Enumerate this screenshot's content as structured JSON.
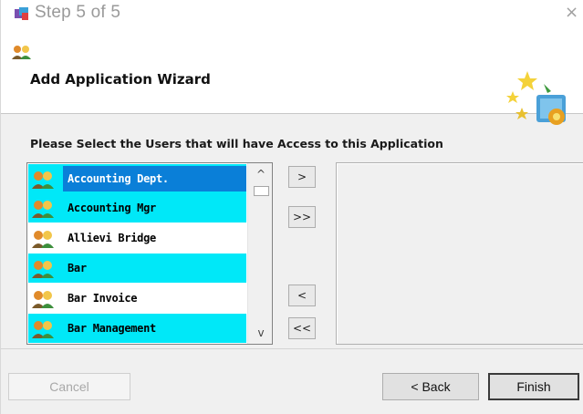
{
  "window": {
    "title": "Step 5 of 5",
    "close_glyph": "×"
  },
  "header": {
    "title": "Add Application Wizard",
    "small_icon": "users-icon",
    "art_icon": "wizard-stars-icon"
  },
  "instruction": "Please Select the Users that will have Access to this Application",
  "user_list": {
    "items": [
      {
        "label": "Accounting Dept.",
        "state": "selected"
      },
      {
        "label": "Accounting Mgr",
        "state": "highlighted"
      },
      {
        "label": "Allievi Bridge",
        "state": "normal"
      },
      {
        "label": "Bar",
        "state": "highlighted"
      },
      {
        "label": "Bar Invoice",
        "state": "normal"
      },
      {
        "label": "Bar Management",
        "state": "highlighted"
      }
    ],
    "scroll_up": "^",
    "scroll_down": "v"
  },
  "move_buttons": {
    "add_one": ">",
    "add_all": ">>",
    "remove_one": "<",
    "remove_all": "<<"
  },
  "buttons": {
    "cancel": "Cancel",
    "back": "< Back",
    "finish": "Finish"
  },
  "colors": {
    "selected_bg": "#0a7fd8",
    "highlight_bg": "#00e8f8"
  }
}
